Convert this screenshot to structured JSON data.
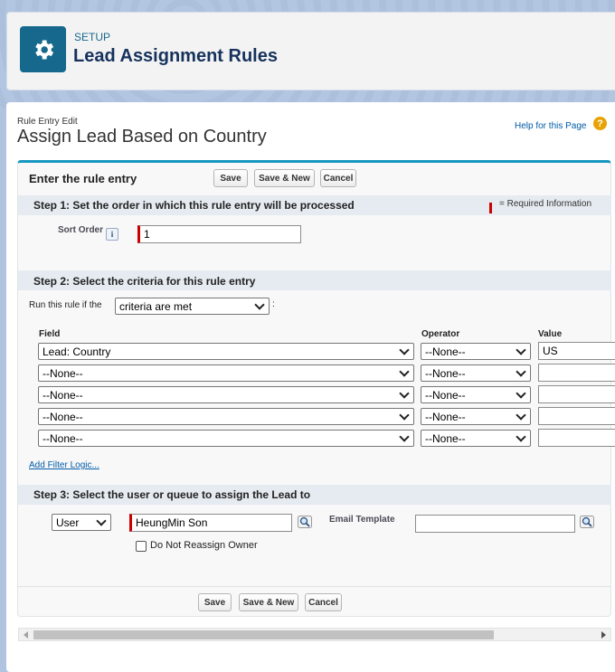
{
  "header": {
    "setup_label": "SETUP",
    "title": "Lead Assignment Rules",
    "icon": "gear-icon"
  },
  "page": {
    "breadcrumb": "Rule Entry Edit",
    "title": "Assign Lead Based on Country",
    "help_link": "Help for this Page",
    "help_icon_glyph": "?"
  },
  "panel": {
    "title": "Enter the rule entry",
    "buttons": {
      "save": "Save",
      "save_new": "Save & New",
      "cancel": "Cancel"
    }
  },
  "step1": {
    "title": "Step 1: Set the order in which this rule entry will be processed",
    "required_text": "= Required Information",
    "sort_order_label": "Sort Order",
    "info_glyph": "i",
    "sort_order_value": "1"
  },
  "step2": {
    "title": "Step 2: Select the criteria for this rule entry",
    "run_rule_label": "Run this rule if the",
    "run_rule_value": "criteria are met",
    "run_rule_suffix": ":",
    "columns": {
      "field": "Field",
      "operator": "Operator",
      "value": "Value"
    },
    "rows": [
      {
        "field": "Lead: Country",
        "operator": "--None--",
        "value": "US"
      },
      {
        "field": "--None--",
        "operator": "--None--",
        "value": ""
      },
      {
        "field": "--None--",
        "operator": "--None--",
        "value": ""
      },
      {
        "field": "--None--",
        "operator": "--None--",
        "value": ""
      },
      {
        "field": "--None--",
        "operator": "--None--",
        "value": ""
      }
    ],
    "add_filter_logic": "Add Filter Logic..."
  },
  "step3": {
    "title": "Step 3: Select the user or queue to assign the Lead to",
    "assignee_type": "User",
    "assignee_value": "HeungMin Son",
    "email_template_label": "Email Template",
    "email_template_value": "",
    "do_not_reassign_label": "Do Not Reassign Owner"
  },
  "footer_buttons": {
    "save": "Save",
    "save_new": "Save & New",
    "cancel": "Cancel"
  },
  "colors": {
    "accent": "#16688c",
    "required": "#cc0000",
    "panel_border": "#1797c0"
  }
}
